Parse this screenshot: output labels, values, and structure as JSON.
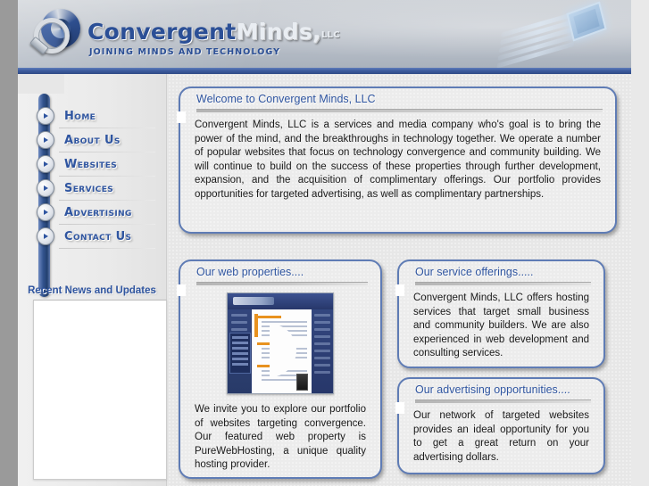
{
  "header": {
    "logo_icon": "magnifying-glass-swirl-logo",
    "brand_primary": "Convergent",
    "brand_secondary": "Minds,",
    "brand_suffix": "LLC",
    "tagline": "JOINING MINDS AND TECHNOLOGY",
    "art_icon": "computer-keyboard-graphic",
    "accent_blue": "#2f55a0",
    "bar_blue": "#3d5c9e"
  },
  "sidebar": {
    "items": [
      {
        "label": "Home",
        "icon": "arrow-right-circle-icon"
      },
      {
        "label": "About Us",
        "icon": "arrow-right-circle-icon"
      },
      {
        "label": "Websites",
        "icon": "arrow-right-circle-icon"
      },
      {
        "label": "Services",
        "icon": "arrow-right-circle-icon"
      },
      {
        "label": "Advertising",
        "icon": "arrow-right-circle-icon"
      },
      {
        "label": "Contact Us",
        "icon": "arrow-right-circle-icon"
      }
    ],
    "news_title": "Recent News and Updates",
    "news_body": ""
  },
  "panels": {
    "welcome": {
      "title": "Welcome to Convergent Minds, LLC",
      "body": "Convergent Minds, LLC is a services and media company who's goal is to bring the power of the mind, and the breakthroughs in technology together. We operate a number of popular websites that focus on technology convergence and community building. We will continue to build on the success of these properties through further development, expansion, and the acquisition of complimentary offerings. Our portfolio provides opportunities for targeted advertising, as well as complimentary partnerships."
    },
    "web_properties": {
      "title": "Our web properties....",
      "thumbnail_icon": "website-screenshot-thumbnail",
      "body": "We invite you to explore our portfolio of websites targeting convergence. Our featured web property is PureWebHosting, a unique quality hosting provider."
    },
    "services": {
      "title": "Our service offerings.....",
      "body": "Convergent Minds, LLC offers hosting services that target small business and community builders. We are also experienced in web development and consulting services."
    },
    "advertising": {
      "title": "Our advertising opportunities....",
      "body": "Our network of targeted websites provides an ideal opportunity for you to get a great return on your advertising dollars."
    }
  }
}
